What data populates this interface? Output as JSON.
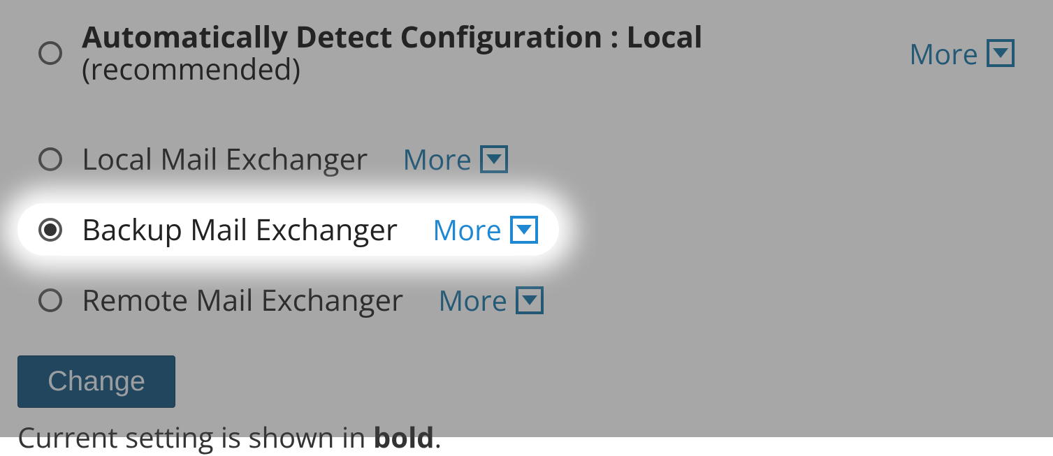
{
  "options": [
    {
      "label": "Automatically Detect Configuration : Local",
      "suffix": "(recommended)",
      "bold": true,
      "selected": false,
      "more": "More"
    },
    {
      "label": "Local Mail Exchanger",
      "suffix": "",
      "bold": false,
      "selected": false,
      "more": "More"
    },
    {
      "label": "Backup Mail Exchanger",
      "suffix": "",
      "bold": false,
      "selected": true,
      "more": "More"
    },
    {
      "label": "Remote Mail Exchanger",
      "suffix": "",
      "bold": false,
      "selected": false,
      "more": "More"
    }
  ],
  "change_button": "Change",
  "note_prefix": "Current setting is shown in ",
  "note_bold": "bold",
  "note_suffix": "."
}
